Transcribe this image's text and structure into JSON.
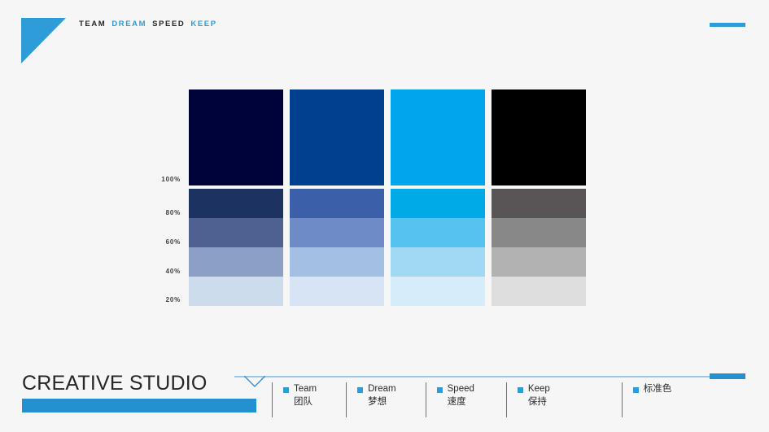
{
  "header": {
    "logo_icon": "blue-triangle-logo",
    "brand_words": [
      {
        "text": "TEAM",
        "color": "#262626"
      },
      {
        "text": "DREAM",
        "color": "#2e9cd8"
      },
      {
        "text": "SPEED",
        "color": "#262626"
      },
      {
        "text": "KEEP",
        "color": "#2e9cd8"
      }
    ],
    "accent_bar_color": "#2e9cd8"
  },
  "palette": {
    "axis_labels": [
      "100%",
      "80%",
      "60%",
      "40%",
      "20%"
    ],
    "columns": [
      {
        "name": "Team",
        "main": "#00033a",
        "tints": [
          "#1c3361",
          "#4f6191",
          "#8ba0c4",
          "#ccdcec"
        ]
      },
      {
        "name": "Dream",
        "main": "#00408f",
        "tints": [
          "#3b5fa8",
          "#6e8bc8",
          "#a4bfe4",
          "#d6e4f5"
        ]
      },
      {
        "name": "Speed",
        "main": "#00a5ee",
        "tints": [
          "#00aae6",
          "#55c3ef",
          "#a1d9f5",
          "#d5ecfa"
        ]
      },
      {
        "name": "Keep",
        "main": "#000000",
        "tints": [
          "#595455",
          "#888888",
          "#b2b2b2",
          "#dedede"
        ]
      }
    ]
  },
  "footer": {
    "title": "CREATIVE STUDIO",
    "bar_color": "#2490d0",
    "line_color": "#9ec8e8",
    "legend": [
      {
        "en": "Team",
        "zh": "团队"
      },
      {
        "en": "Dream",
        "zh": "梦想"
      },
      {
        "en": "Speed",
        "zh": "速度"
      },
      {
        "en": "Keep",
        "zh": "保持"
      },
      {
        "en": "标准色",
        "zh": ""
      }
    ]
  }
}
